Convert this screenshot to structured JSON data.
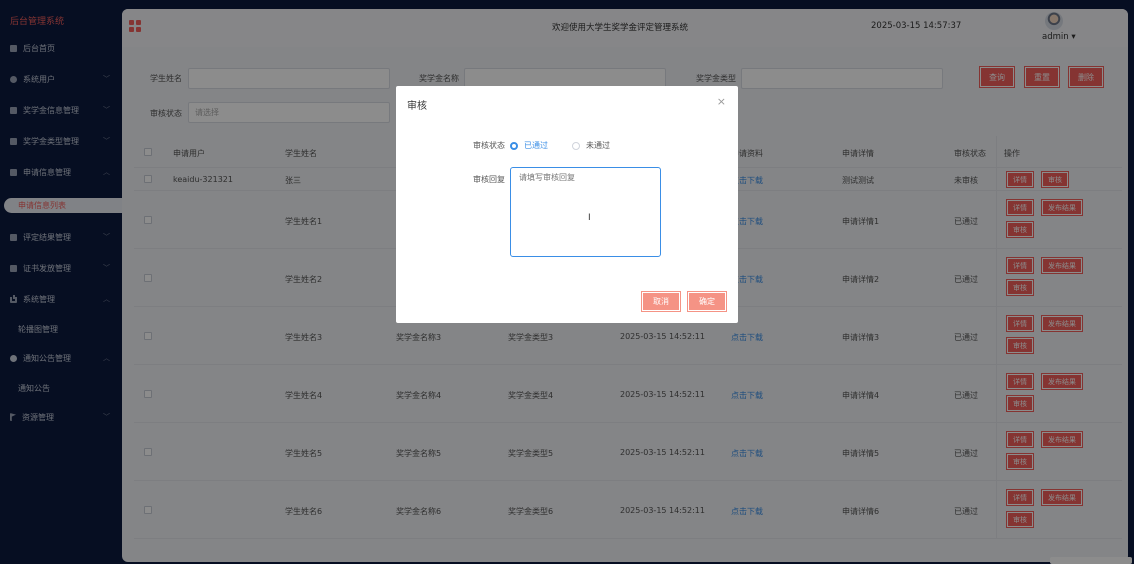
{
  "sidebar": {
    "title": "后台管理系统",
    "items": [
      {
        "label": "后台首页",
        "icon": "monitor-icon"
      },
      {
        "label": "系统用户",
        "icon": "person-icon"
      },
      {
        "label": "奖学金信息管理",
        "icon": "checkbox-icon"
      },
      {
        "label": "奖学金类型管理",
        "icon": "checkbox-icon"
      },
      {
        "label": "申请信息管理",
        "icon": "checkbox-icon"
      },
      {
        "label": "申请信息列表",
        "icon": ""
      },
      {
        "label": "评定结果管理",
        "icon": "checkbox-icon"
      },
      {
        "label": "证书发放管理",
        "icon": "checkbox-icon"
      },
      {
        "label": "系统管理",
        "icon": "bar-chart-icon"
      },
      {
        "label": "轮播图管理",
        "icon": ""
      },
      {
        "label": "通知公告管理",
        "icon": "info-icon"
      },
      {
        "label": "通知公告",
        "icon": ""
      },
      {
        "label": "资源管理",
        "icon": "flag-icon"
      }
    ]
  },
  "header": {
    "welcome": "欢迎使用大学生奖学金评定管理系统",
    "datetime": "2025-03-15 14:57:37",
    "user": "admin ▾"
  },
  "filters": {
    "student_name_label": "学生姓名",
    "scholarship_name_label": "奖学金名称",
    "scholarship_type_label": "奖学金类型",
    "review_status_label": "审核状态",
    "review_status_placeholder": "请选择",
    "query_button": "查询",
    "reset_button": "重置",
    "delete_button": "删除"
  },
  "table": {
    "headers": [
      "申请用户",
      "学生姓名",
      "",
      "",
      "",
      "申请资料",
      "申请详情",
      "审核状态",
      "操作"
    ],
    "rows": [
      {
        "user": "keaidu-321321",
        "name": "张三",
        "scholarship": "",
        "type": "",
        "time": "",
        "material": "点击下载",
        "detail": "测试测试",
        "status": "未审核",
        "ops": [
          "详情",
          "审核"
        ]
      },
      {
        "user": "",
        "name": "学生姓名1",
        "scholarship": "",
        "type": "",
        "time": "",
        "material": "点击下载",
        "detail": "申请详情1",
        "status": "已通过",
        "ops": [
          "详情",
          "发布结果",
          "审核"
        ]
      },
      {
        "user": "",
        "name": "学生姓名2",
        "scholarship": "",
        "type": "",
        "time": "",
        "material": "点击下载",
        "detail": "申请详情2",
        "status": "已通过",
        "ops": [
          "详情",
          "发布结果",
          "审核"
        ]
      },
      {
        "user": "",
        "name": "学生姓名3",
        "scholarship": "奖学金名称3",
        "type": "奖学金类型3",
        "time": "2025-03-15 14:52:11",
        "material": "点击下载",
        "detail": "申请详情3",
        "status": "已通过",
        "ops": [
          "详情",
          "发布结果",
          "审核"
        ]
      },
      {
        "user": "",
        "name": "学生姓名4",
        "scholarship": "奖学金名称4",
        "type": "奖学金类型4",
        "time": "2025-03-15 14:52:11",
        "material": "点击下载",
        "detail": "申请详情4",
        "status": "已通过",
        "ops": [
          "详情",
          "发布结果",
          "审核"
        ]
      },
      {
        "user": "",
        "name": "学生姓名5",
        "scholarship": "奖学金名称5",
        "type": "奖学金类型5",
        "time": "2025-03-15 14:52:11",
        "material": "点击下载",
        "detail": "申请详情5",
        "status": "已通过",
        "ops": [
          "详情",
          "发布结果",
          "审核"
        ]
      },
      {
        "user": "",
        "name": "学生姓名6",
        "scholarship": "奖学金名称6",
        "type": "奖学金类型6",
        "time": "2025-03-15 14:52:11",
        "material": "点击下载",
        "detail": "申请详情6",
        "status": "已通过",
        "ops": [
          "详情",
          "发布结果",
          "审核"
        ]
      }
    ]
  },
  "modal": {
    "title": "审核",
    "close": "×",
    "status_label": "审核状态",
    "option_pass": "已通过",
    "option_fail": "未通过",
    "reply_label": "审核回复",
    "reply_placeholder": "请填写审核回复",
    "cancel_button": "取消",
    "confirm_button": "确定"
  },
  "colors": {
    "accent": "#f25f5c",
    "link": "#3a8ee6",
    "sidebar_bg": "#0c1a3f"
  }
}
